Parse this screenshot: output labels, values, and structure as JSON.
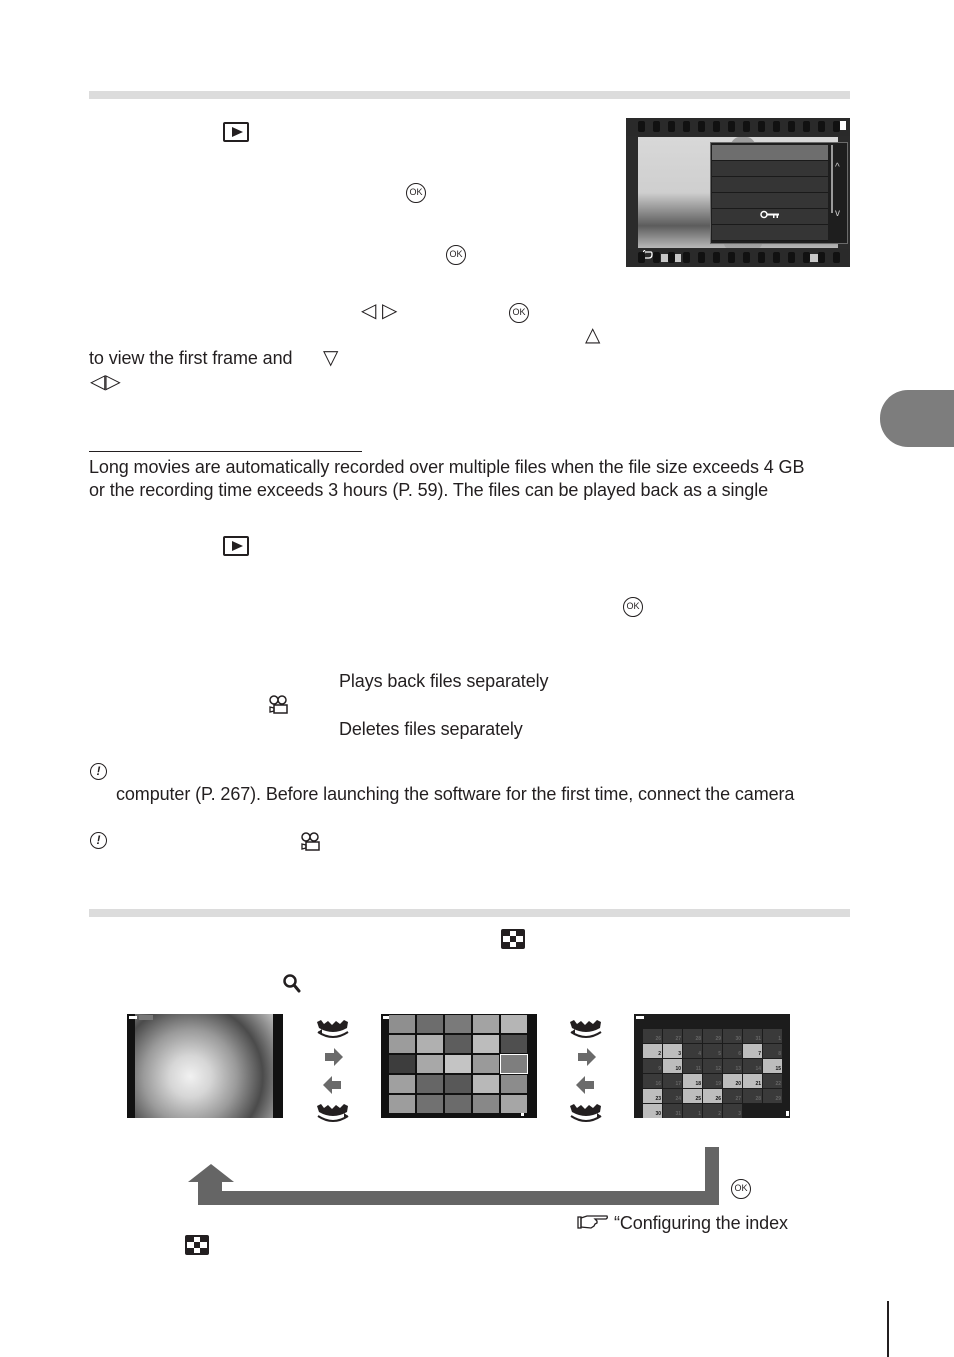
{
  "page": {
    "chapter_tab_color": "#7d7d7d",
    "section_bar_color": "#dcdcdc"
  },
  "section1": {
    "icons": {
      "play": "playback-button-icon",
      "ok_1": "OK",
      "ok_2": "OK",
      "ok_3": "OK",
      "left_right": "◁ ▷",
      "up": "△",
      "down": "▽",
      "left_right_2": "◁▷"
    },
    "line_view_first_frame": "to view the first frame and"
  },
  "camera_menu": {
    "items": [
      "",
      "",
      "",
      "",
      "O‒π",
      ""
    ],
    "selected_index": 0,
    "key_icon": "protect-key-icon",
    "scroll_up": "^",
    "scroll_down": "v",
    "back_symbol": "⮌"
  },
  "section2": {
    "body_line_1": "Long movies are automatically recorded over multiple files when the file size exceeds 4 GB",
    "body_line_2": "or the recording time exceeds 3 hours (P. 59). The files can be played back as a single",
    "option_play": "Plays back files separately",
    "option_delete": "Deletes files separately",
    "note_line_2": "computer (P. 267).  Before launching the software for the first time, connect the camera",
    "ok_label": "OK"
  },
  "section3": {
    "ok_label": "OK",
    "reference_text": "“Configuring the index",
    "calendar_days": [
      [
        "26",
        "27",
        "28",
        "29",
        "30",
        "31",
        "1"
      ],
      [
        "2",
        "3",
        "4",
        "5",
        "6",
        "7",
        "8"
      ],
      [
        "9",
        "10",
        "11",
        "12",
        "13",
        "14",
        "15"
      ],
      [
        "16",
        "17",
        "18",
        "19",
        "20",
        "21",
        "22"
      ],
      [
        "23",
        "24",
        "25",
        "26",
        "27",
        "28",
        "29"
      ],
      [
        "30",
        "31",
        "1",
        "2",
        "3"
      ]
    ],
    "calendar_days_with_images": [
      "2",
      "3",
      "7",
      "10",
      "15",
      "18",
      "20",
      "21",
      "23",
      "25",
      "26",
      "30"
    ]
  }
}
